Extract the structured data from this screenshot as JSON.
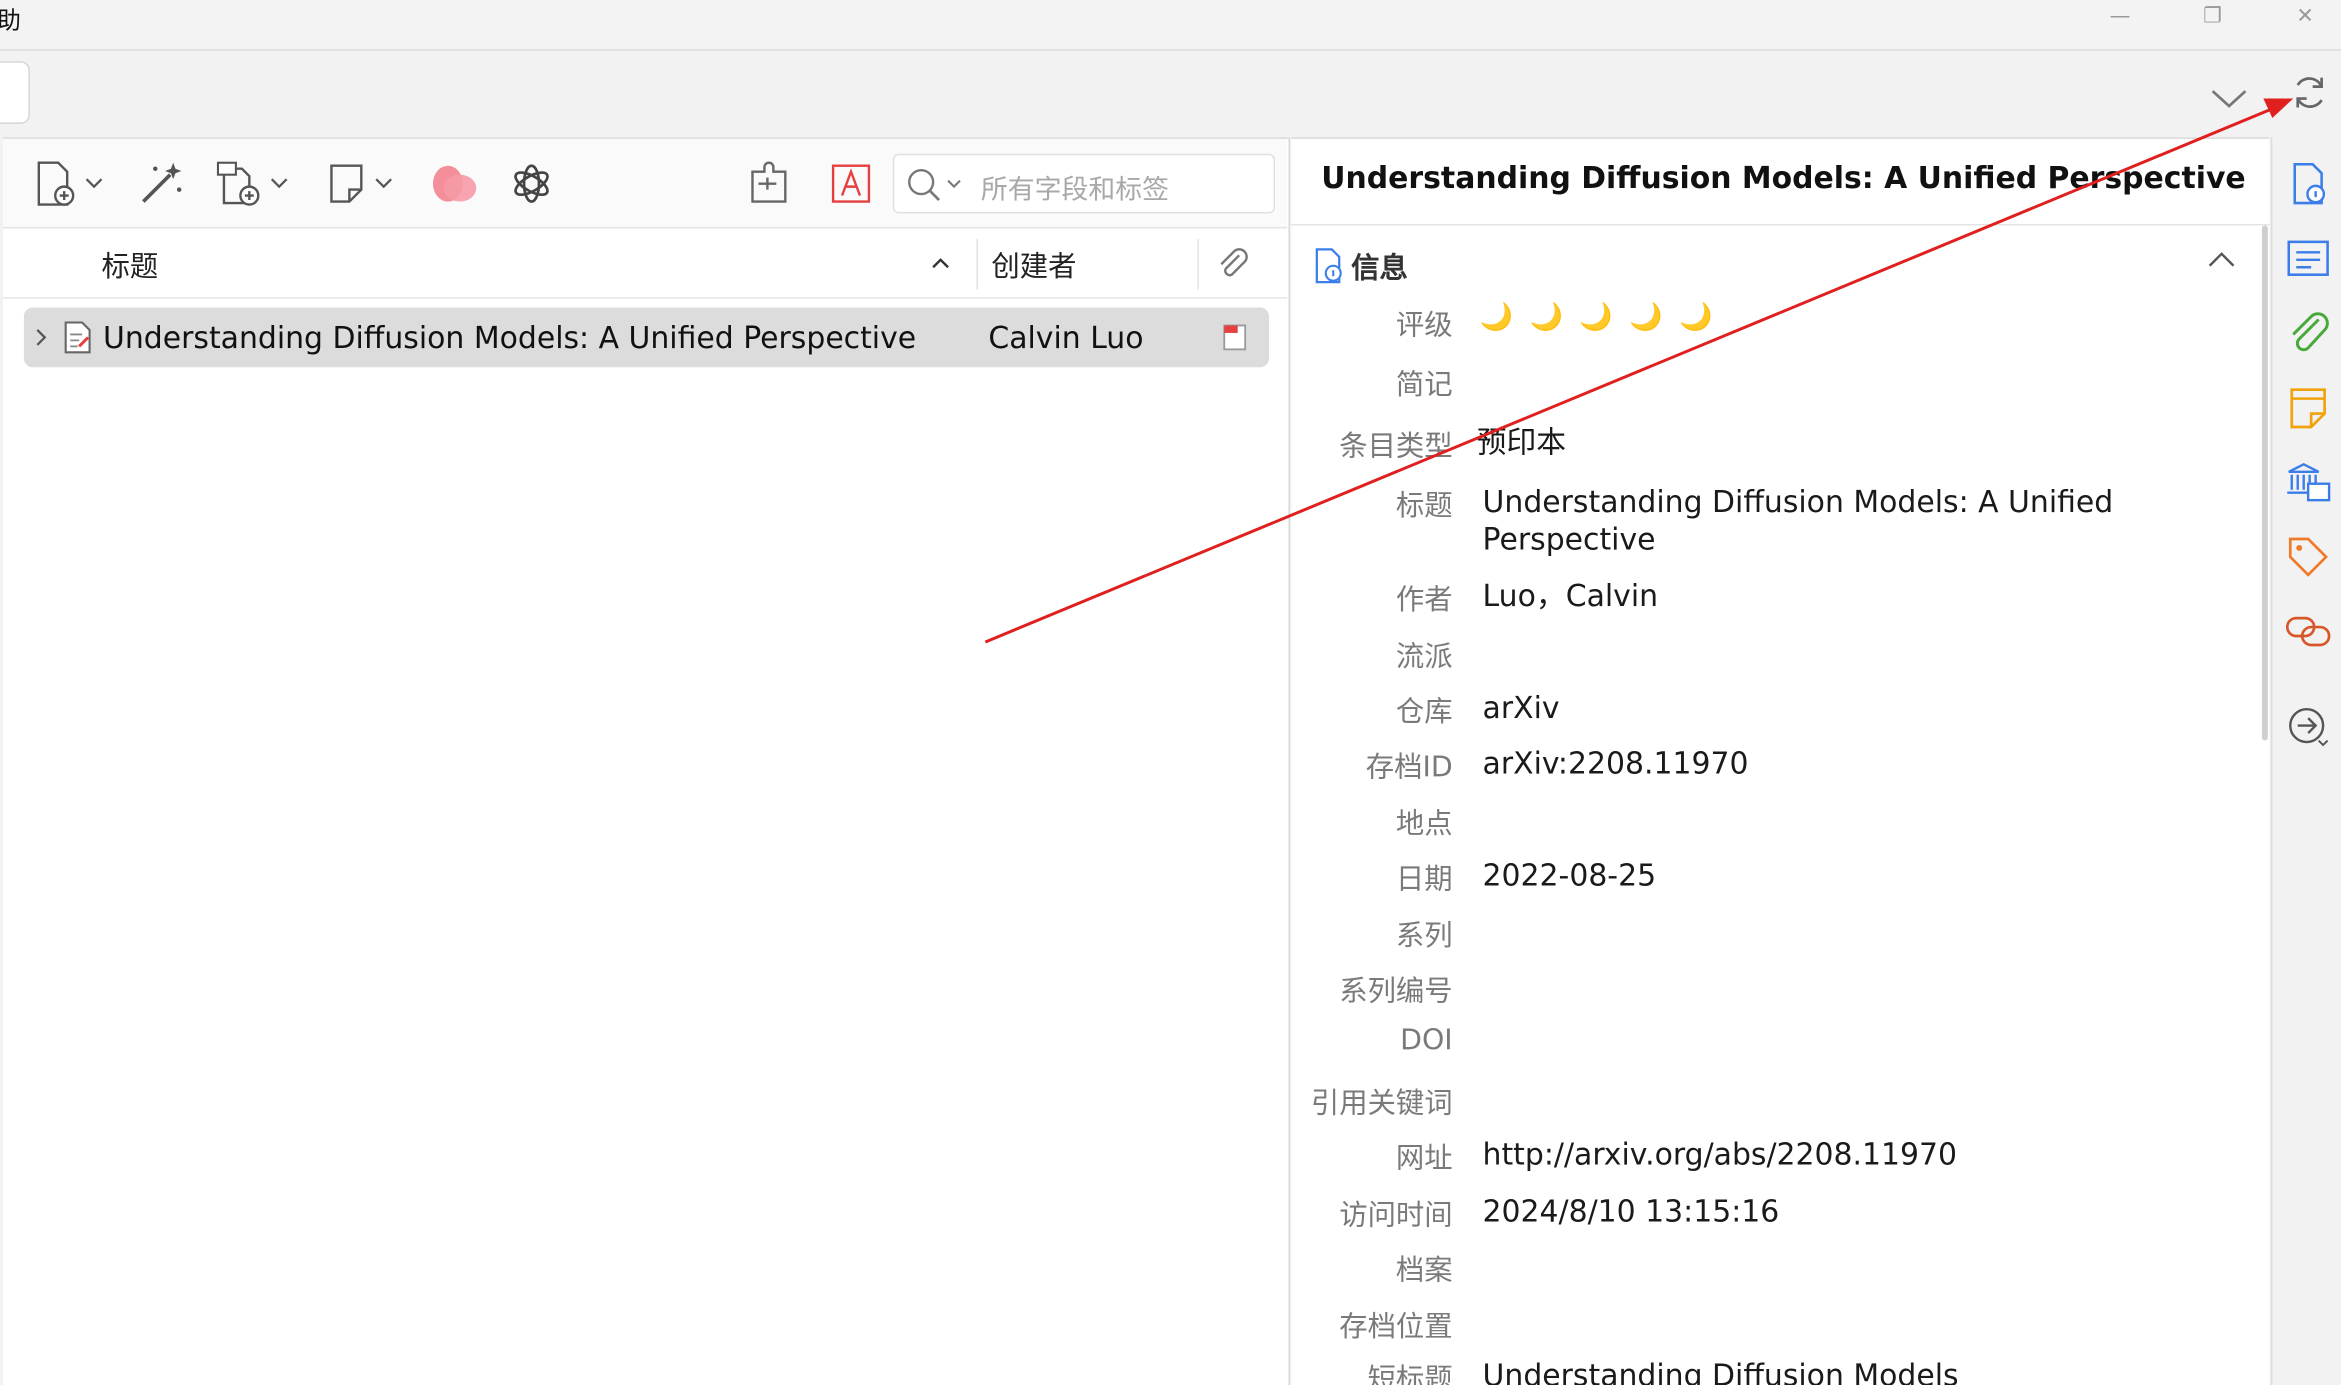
{
  "menu": {
    "fragment": "助"
  },
  "window": {
    "minimize": "—",
    "restore": "❐",
    "close": "✕"
  },
  "search": {
    "placeholder": "所有字段和标签"
  },
  "columns": {
    "title": "标题",
    "creator": "创建者"
  },
  "items": [
    {
      "title": "Understanding Diffusion Models: A Unified Perspective",
      "creator": "Calvin Luo",
      "has_pdf": true
    }
  ],
  "item_pane": {
    "header_title": "Understanding Diffusion Models: A Unified Perspective",
    "section_label": "信息",
    "rating_stars": 5,
    "fields": [
      {
        "key": "评级",
        "value": ""
      },
      {
        "key": "简记",
        "value": ""
      },
      {
        "key": "条目类型",
        "value": "预印本"
      },
      {
        "key": "标题",
        "value": "Understanding Diffusion Models: A Unified Perspective"
      },
      {
        "key": "作者",
        "value": "Luo，Calvin"
      },
      {
        "key": "流派",
        "value": ""
      },
      {
        "key": "仓库",
        "value": "arXiv"
      },
      {
        "key": "存档ID",
        "value": "arXiv:2208.11970"
      },
      {
        "key": "地点",
        "value": ""
      },
      {
        "key": "日期",
        "value": "2022-08-25"
      },
      {
        "key": "系列",
        "value": ""
      },
      {
        "key": "系列编号",
        "value": ""
      },
      {
        "key": "DOI",
        "value": ""
      },
      {
        "key": "引用关键词",
        "value": ""
      },
      {
        "key": "网址",
        "value": "http://arxiv.org/abs/2208.11970"
      },
      {
        "key": "访问时间",
        "value": "2024/8/10 13:15:16"
      },
      {
        "key": "档案",
        "value": ""
      },
      {
        "key": "存档位置",
        "value": ""
      },
      {
        "key": "短标题",
        "value": "Understanding Diffusion Models"
      }
    ]
  },
  "colors": {
    "accent": "#3b7de9",
    "annotation": "#e0201e",
    "attachments": "#47a93a",
    "notes": "#f0a30a",
    "tags": "#f07a2a",
    "related": "#d8572a"
  }
}
